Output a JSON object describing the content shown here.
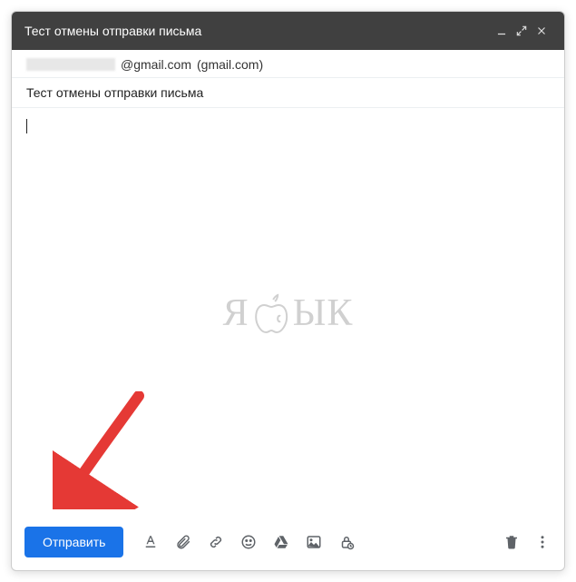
{
  "header": {
    "title": "Тест отмены отправки письма"
  },
  "to": {
    "redacted": true,
    "domain": "@gmail.com",
    "suffix": "(gmail.com)"
  },
  "subject": "Тест отмены отправки письма",
  "watermark": {
    "left": "Я",
    "right": "ЫК"
  },
  "toolbar": {
    "send_label": "Отправить"
  },
  "icons": {
    "minimize": "minimize-icon",
    "expand": "expand-icon",
    "close": "close-icon",
    "format": "format-icon",
    "attach": "attach-icon",
    "link": "link-icon",
    "emoji": "emoji-icon",
    "drive": "drive-icon",
    "image": "image-icon",
    "confidential": "confidential-icon",
    "trash": "trash-icon",
    "more": "more-icon"
  }
}
